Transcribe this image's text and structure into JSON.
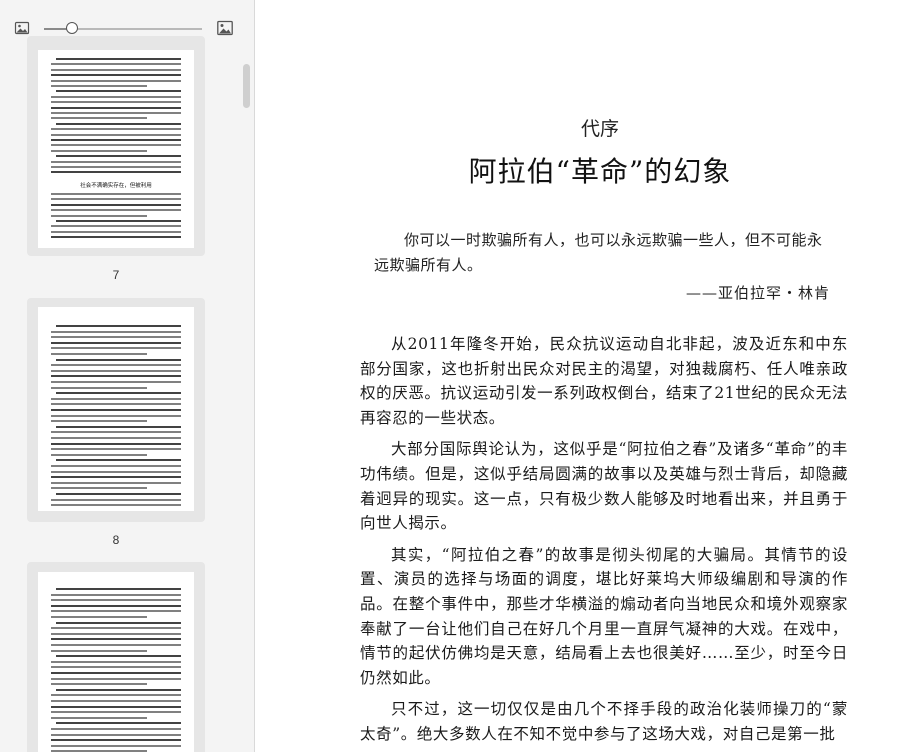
{
  "sidebar": {
    "zoom_level": 0.18,
    "pages": [
      {
        "number": "7",
        "heading": "社会不满确实存在，但被利用"
      },
      {
        "number": "8"
      },
      {
        "number": ""
      }
    ]
  },
  "document": {
    "subtitle": "代序",
    "title": "阿拉伯“革命”的幻象",
    "epigraph": "你可以一时欺骗所有人，也可以永远欺骗一些人，但不可能永远欺骗所有人。",
    "attribution": "——亚伯拉罕・林肯",
    "paragraphs": [
      "从2011年隆冬开始，民众抗议运动自北非起，波及近东和中东部分国家，这也折射出民众对民主的渴望，对独裁腐朽、任人唯亲政权的厌恶。抗议运动引发一系列政权倒台，结束了21世纪的民众无法再容忍的一些状态。",
      "大部分国际舆论认为，这似乎是“阿拉伯之春”及诸多“革命”的丰功伟绩。但是，这似乎结局圆满的故事以及英雄与烈士背后，却隐藏着迥异的现实。这一点，只有极少数人能够及时地看出来，并且勇于向世人揭示。",
      "其实，“阿拉伯之春”的故事是彻头彻尾的大骗局。其情节的设置、演员的选择与场面的调度，堪比好莱坞大师级编剧和导演的作品。在整个事件中，那些才华横溢的煽动者向当地民众和境外观察家奉献了一台让他们自己在好几个月里一直屏气凝神的大戏。在戏中，情节的起伏仿佛均是天意，结局看上去也很美好……至少，时至今日仍然如此。",
      "只不过，这一切仅仅是由几个不择手段的政治化装师操刀的“蒙太奇”。绝大多数人在不知不觉中参与了这场大戏，对自己是第一批"
    ]
  }
}
